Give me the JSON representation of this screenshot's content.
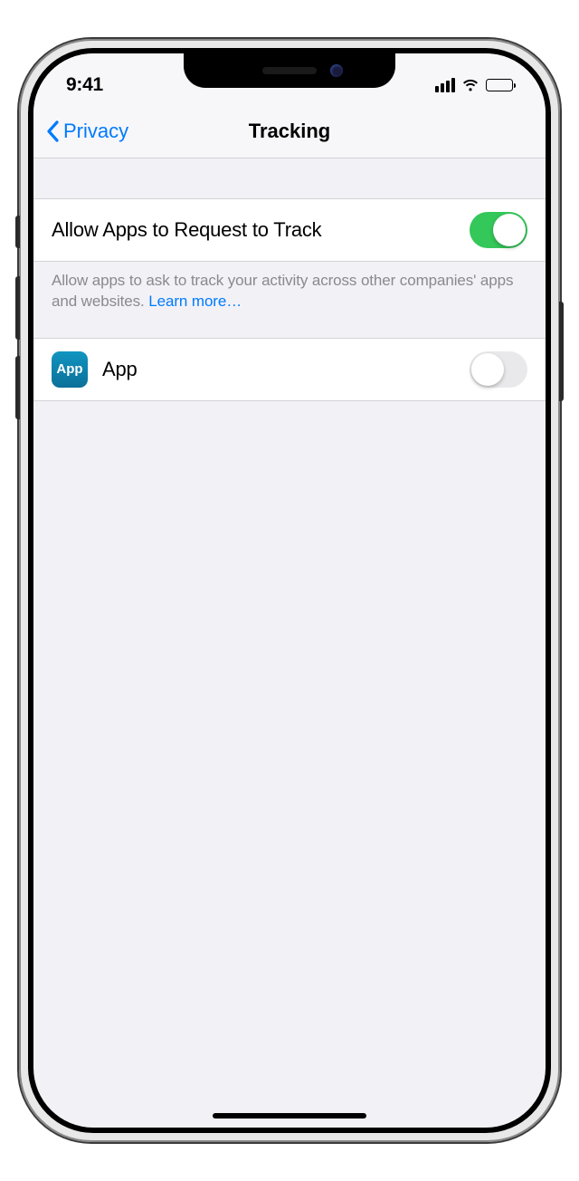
{
  "statusBar": {
    "time": "9:41"
  },
  "nav": {
    "back_label": "Privacy",
    "title": "Tracking"
  },
  "settings": {
    "allow_tracking": {
      "label": "Allow Apps to Request to Track",
      "state": true
    },
    "footer_text": "Allow apps to ask to track your activity across other companies' apps and websites. ",
    "footer_link": "Learn more…"
  },
  "apps": [
    {
      "icon_text": "App",
      "name": "App",
      "state": false
    }
  ]
}
